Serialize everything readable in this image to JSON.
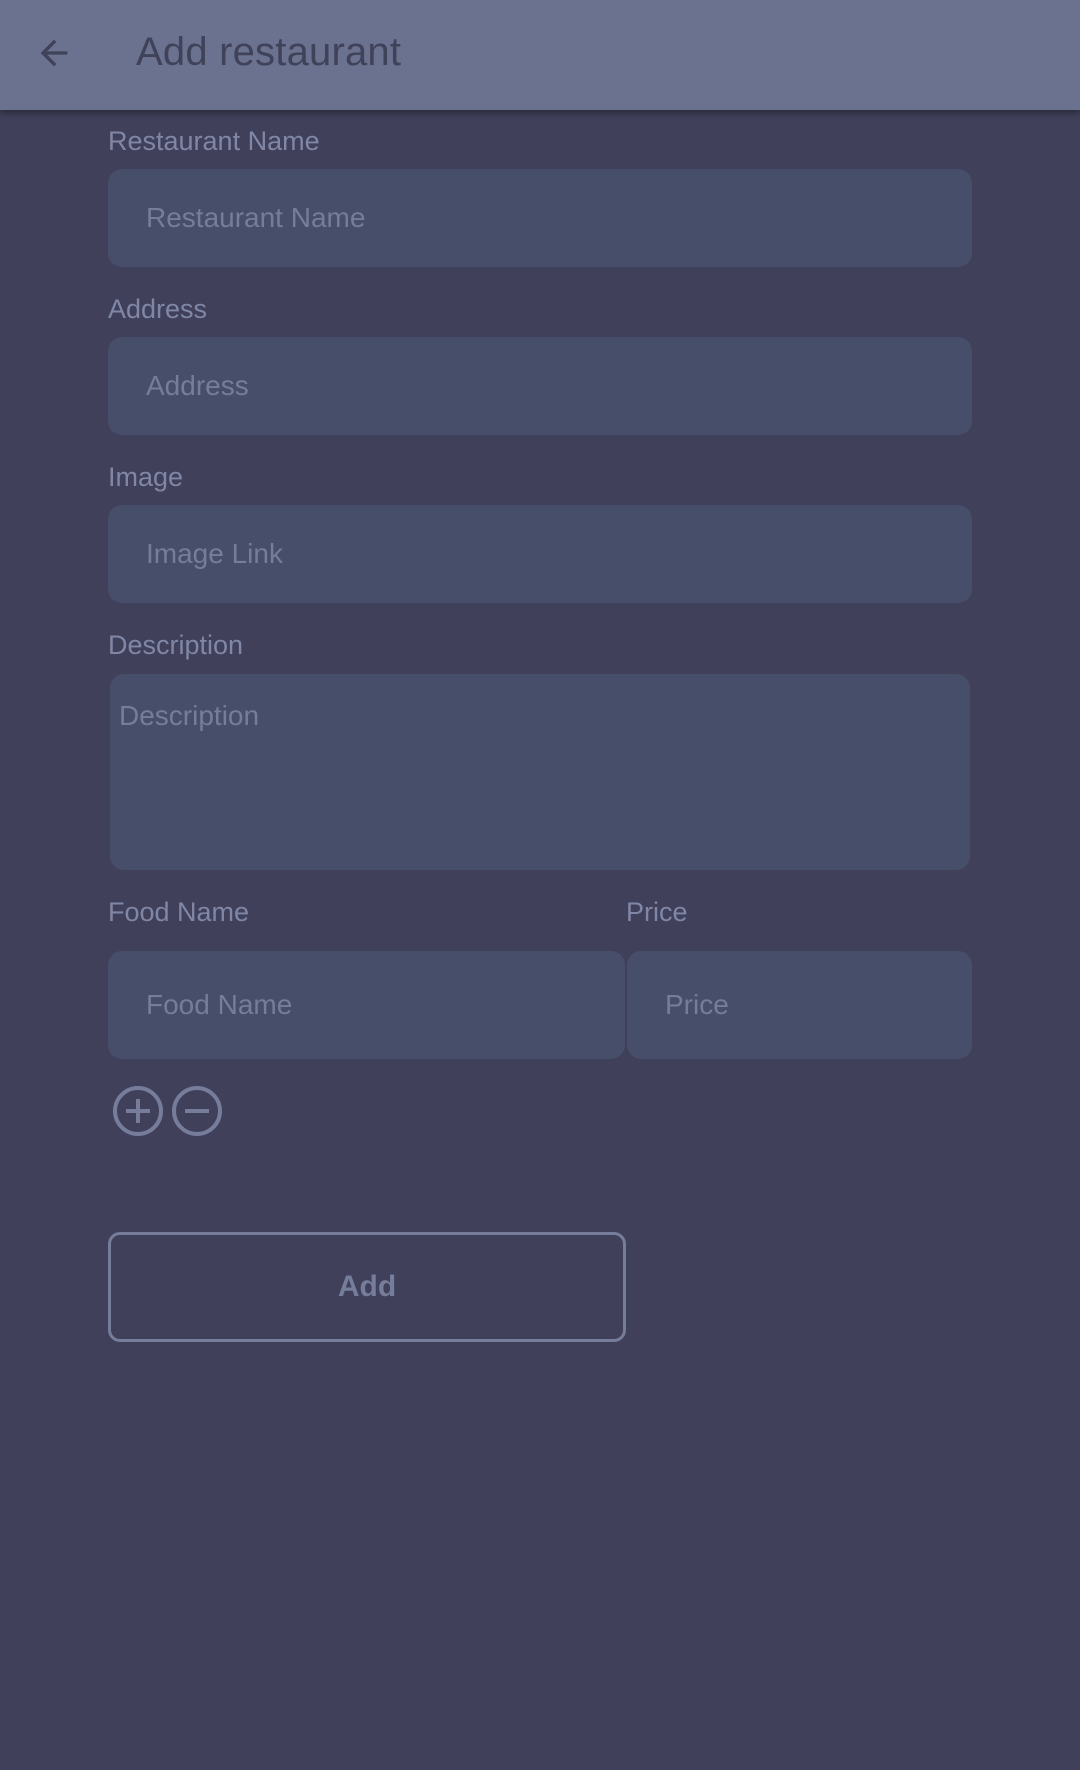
{
  "appbar": {
    "title": "Add restaurant",
    "back_icon": "arrow-left-icon"
  },
  "form": {
    "restaurant_name": {
      "label": "Restaurant Name",
      "placeholder": "Restaurant Name",
      "value": ""
    },
    "address": {
      "label": "Address",
      "placeholder": "Address",
      "value": ""
    },
    "image": {
      "label": "Image",
      "placeholder": "Image Link",
      "value": ""
    },
    "description": {
      "label": "Description",
      "placeholder": "Description",
      "value": ""
    },
    "food_name": {
      "label": "Food Name",
      "placeholder": "Food Name",
      "value": ""
    },
    "price": {
      "label": "Price",
      "placeholder": "Price",
      "value": ""
    },
    "add_item_icon": "plus-circle-icon",
    "remove_item_icon": "minus-circle-icon",
    "submit_label": "Add"
  },
  "colors": {
    "background": "#40405a",
    "appbar": "#6b7290",
    "field": "#474e69",
    "label": "#8087a6",
    "placeholder": "#767d9a"
  }
}
